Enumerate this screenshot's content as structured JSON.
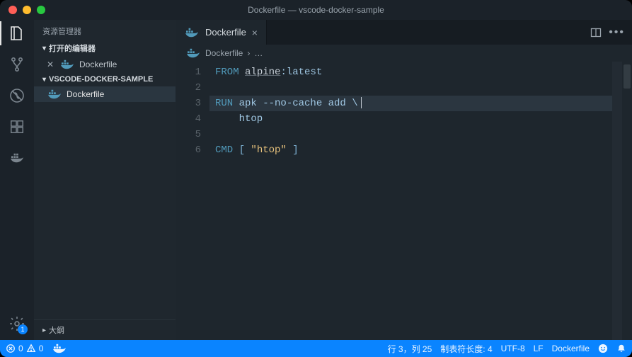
{
  "window": {
    "title": "Dockerfile — vscode-docker-sample"
  },
  "activity": {
    "gear_badge": "1"
  },
  "sidebar": {
    "title": "资源管理器",
    "open_editors_label": "打开的编辑器",
    "open_items": [
      {
        "label": "Dockerfile"
      }
    ],
    "workspace_label": "VSCODE-DOCKER-SAMPLE",
    "tree": [
      {
        "label": "Dockerfile"
      }
    ],
    "outline_label": "大纲"
  },
  "tab": {
    "label": "Dockerfile"
  },
  "breadcrumb": {
    "file": "Dockerfile",
    "sep": "›",
    "rest": "…"
  },
  "code": {
    "lines": [
      {
        "n": "1",
        "tokens": [
          {
            "t": "FROM ",
            "c": "kw"
          },
          {
            "t": "alpine",
            "c": "img"
          },
          {
            "t": ":latest",
            "c": "dir"
          }
        ]
      },
      {
        "n": "2",
        "tokens": []
      },
      {
        "n": "3",
        "hl": true,
        "cursor": true,
        "tokens": [
          {
            "t": "RUN ",
            "c": "kw"
          },
          {
            "t": "apk --no-cache add \\",
            "c": "dir"
          }
        ]
      },
      {
        "n": "4",
        "tokens": [
          {
            "t": "    htop",
            "c": "dir"
          }
        ]
      },
      {
        "n": "5",
        "tokens": []
      },
      {
        "n": "6",
        "tokens": [
          {
            "t": "CMD ",
            "c": "kw"
          },
          {
            "t": "[ ",
            "c": "punc"
          },
          {
            "t": "\"htop\"",
            "c": "str"
          },
          {
            "t": " ]",
            "c": "punc"
          }
        ]
      }
    ]
  },
  "status": {
    "errors": "0",
    "warnings": "0",
    "ln_col": "行 3，列 25",
    "tab_size": "制表符长度: 4",
    "encoding": "UTF-8",
    "eol": "LF",
    "lang": "Dockerfile"
  }
}
